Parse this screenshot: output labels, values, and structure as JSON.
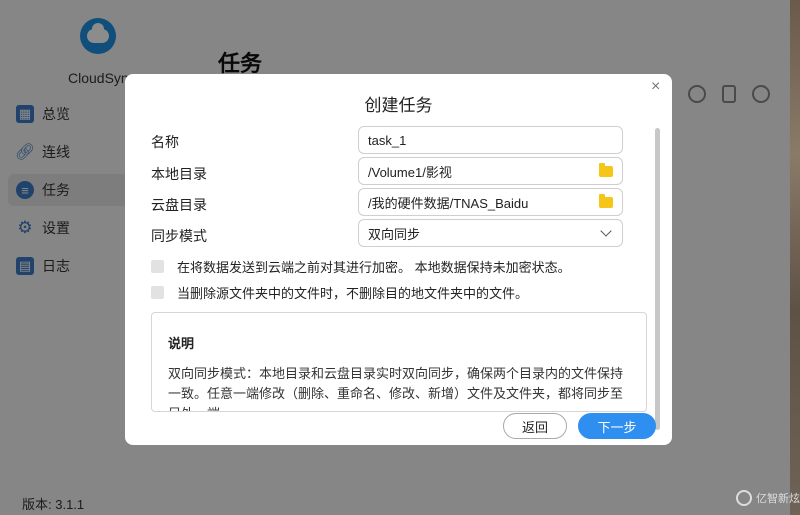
{
  "app": {
    "name": "CloudSync",
    "page_title": "任务",
    "version": "版本: 3.1.1",
    "brand_color": "#1e8fe0"
  },
  "sidebar": {
    "items": [
      {
        "label": "总览",
        "icon": "dashboard-icon",
        "active": false
      },
      {
        "label": "连线",
        "icon": "link-icon",
        "active": false
      },
      {
        "label": "任务",
        "icon": "task-list-icon",
        "active": true
      },
      {
        "label": "设置",
        "icon": "gear-icon",
        "active": false
      },
      {
        "label": "日志",
        "icon": "log-icon",
        "active": false
      }
    ]
  },
  "toolbar": {
    "icons": [
      "check-circle-icon",
      "trash-icon",
      "gear-icon"
    ]
  },
  "dialog": {
    "title": "创建任务",
    "close_glyph": "×",
    "fields": {
      "name": {
        "label": "名称",
        "value": "task_1"
      },
      "local_dir": {
        "label": "本地目录",
        "value": "/Volume1/影视",
        "icon": "folder-icon"
      },
      "cloud_dir": {
        "label": "云盘目录",
        "value": "/我的硬件数据/TNAS_Baidu",
        "icon": "folder-icon"
      },
      "sync_mode": {
        "label": "同步模式",
        "value": "双向同步",
        "icon": "chevron-down-icon"
      }
    },
    "options": {
      "encrypt": "在将数据发送到云端之前对其进行加密。 本地数据保持未加密状态。",
      "keep_on_delete": "当删除源文件夹中的文件时，不删除目的地文件夹中的文件。"
    },
    "note": {
      "title": "说明",
      "text": "双向同步模式：本地目录和云盘目录实时双向同步，确保两个目录内的文件保持一致。任意一端修改（删除、重命名、修改、新增）文件及文件夹，都将同步至另外一端。"
    },
    "buttons": {
      "back": "返回",
      "next": "下一步"
    },
    "accent_color": "#2f8ff0"
  },
  "watermark": {
    "text": "亿智新炫"
  }
}
